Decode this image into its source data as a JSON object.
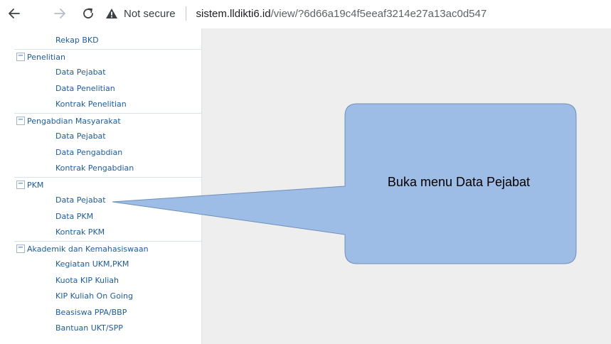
{
  "browser": {
    "security_label": "Not secure",
    "url_host": "sistem.lldikti6.id",
    "url_path": "/view/?6d66a19c4f5eeaf3214e27a13ac0d547"
  },
  "sidebar": {
    "rows": [
      {
        "type": "child",
        "label": "Rekap BKD"
      },
      {
        "type": "section",
        "toggle": "−",
        "label": "Penelitian"
      },
      {
        "type": "child",
        "label": "Data Pejabat"
      },
      {
        "type": "child",
        "label": "Data Penelitian"
      },
      {
        "type": "child",
        "label": "Kontrak Penelitian"
      },
      {
        "type": "section",
        "toggle": "−",
        "label": "Pengabdian Masyarakat"
      },
      {
        "type": "child",
        "label": "Data Pejabat"
      },
      {
        "type": "child",
        "label": "Data Pengabdian"
      },
      {
        "type": "child",
        "label": "Kontrak Pengabdian"
      },
      {
        "type": "section",
        "toggle": "−",
        "label": "PKM"
      },
      {
        "type": "child",
        "label": "Data Pejabat"
      },
      {
        "type": "child",
        "label": "Data PKM"
      },
      {
        "type": "child",
        "label": "Kontrak PKM"
      },
      {
        "type": "section",
        "toggle": "−",
        "label": "Akademik dan Kemahasiswaan"
      },
      {
        "type": "child",
        "label": "Kegiatan UKM,PKM"
      },
      {
        "type": "child",
        "label": "Kuota KIP Kuliah"
      },
      {
        "type": "child",
        "label": "KIP Kuliah On Going"
      },
      {
        "type": "child",
        "label": "Beasiswa PPA/BBP"
      },
      {
        "type": "child",
        "label": "Bantuan UKT/SPP"
      }
    ]
  },
  "callout": {
    "text": "Buka menu Data Pejabat",
    "fill_color": "#9dbde6",
    "stroke_color": "#6f8fb8"
  }
}
